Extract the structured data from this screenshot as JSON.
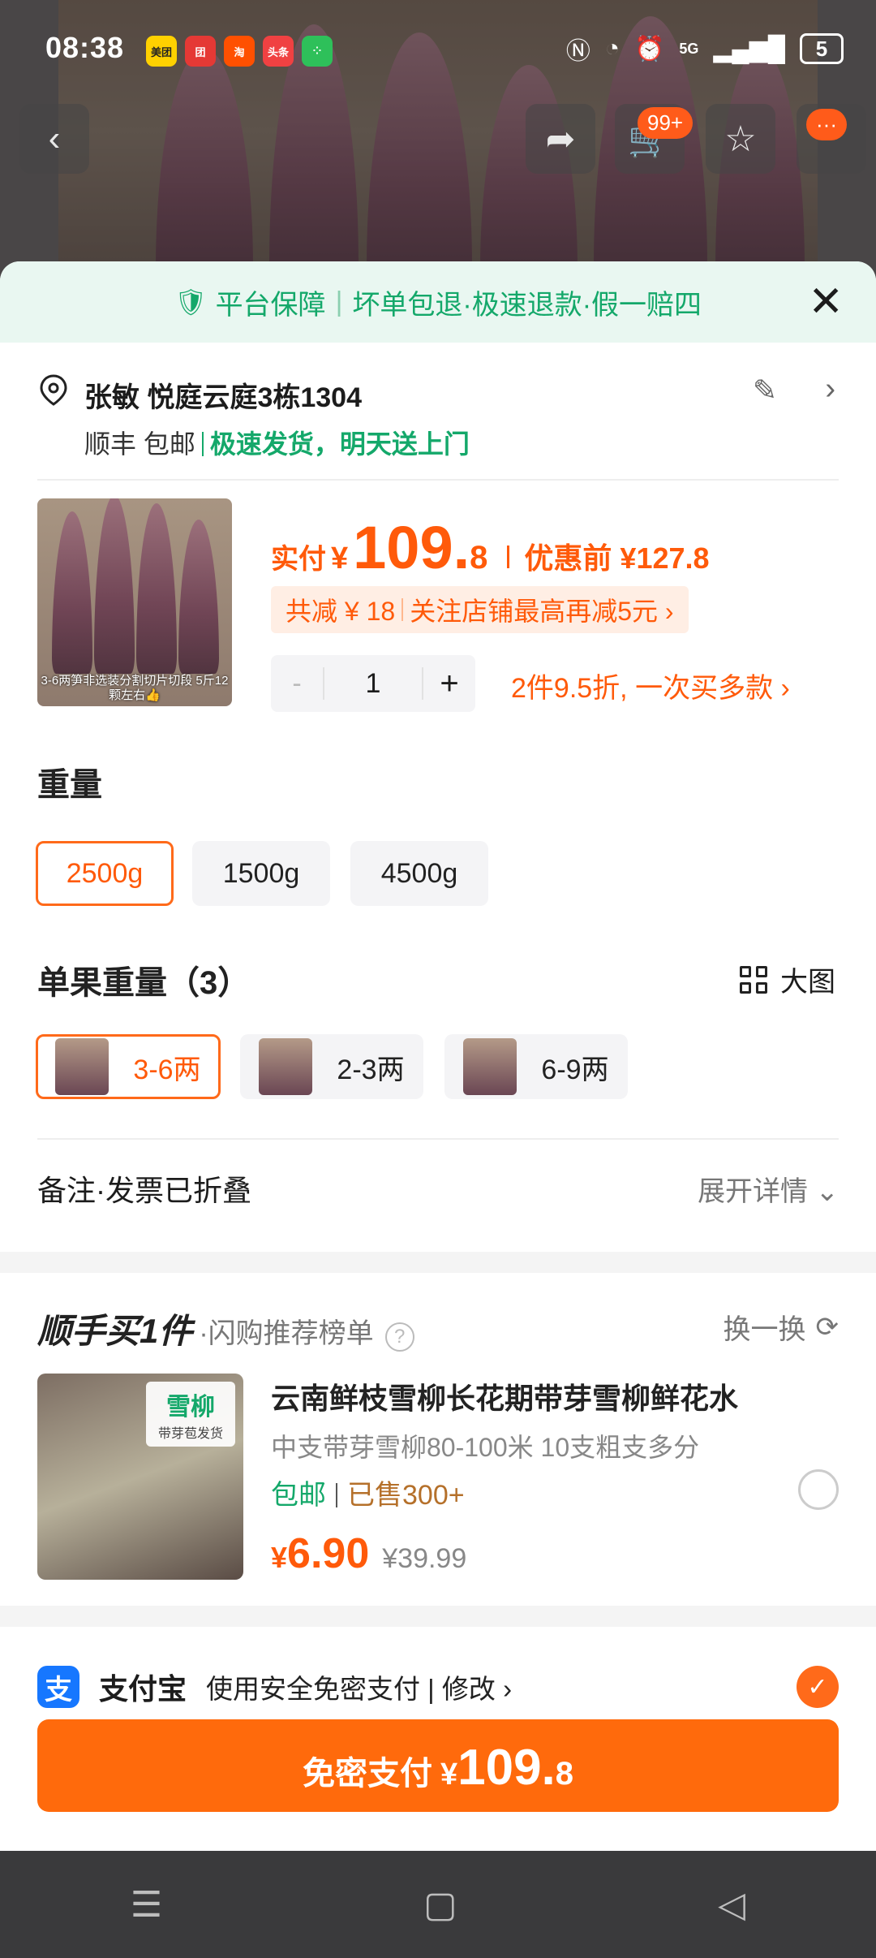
{
  "status": {
    "time": "08:38",
    "apps": [
      {
        "label": "美团",
        "bg": "#ffd100",
        "fg": "#222"
      },
      {
        "label": "团",
        "bg": "#e53935",
        "fg": "#fff"
      },
      {
        "label": "淘",
        "bg": "#ff5000",
        "fg": "#fff"
      },
      {
        "label": "头条",
        "bg": "#f04142",
        "fg": "#fff"
      },
      {
        "label": "⁘",
        "bg": "#2ec05a",
        "fg": "#fff"
      }
    ],
    "icons": [
      "nfc-icon",
      "data-saver-icon",
      "alarm-icon",
      "5g-icon",
      "signal-icon"
    ],
    "network": "5G",
    "battery": "5"
  },
  "header": {
    "cart_badge": "99+",
    "more_badge": "···"
  },
  "guarantee": {
    "title": "平台保障",
    "detail": "坏单包退·极速退款·假一赔四"
  },
  "address": {
    "name_line": "张敏 悦庭云庭3栋1304",
    "shipping": "顺丰 包邮",
    "delivery": "极速发货，明天送上门"
  },
  "product": {
    "thumb_caption": "3-6两笋非选装分割切片切段 5斤12颗左右👍",
    "paid_label": "实付",
    "currency": "¥",
    "price_int": "109.",
    "price_dec": "8",
    "before_label": "优惠前 ¥127.8",
    "discount_total": "共减 ¥ 18",
    "discount_extra": "关注店铺最高再减5元 ›",
    "qty_minus": "-",
    "qty": "1",
    "qty_plus": "+",
    "multi_buy": "2件9.5折, 一次买多款 ›"
  },
  "weight": {
    "title": "重量",
    "options": [
      {
        "label": "2500g",
        "selected": true
      },
      {
        "label": "1500g",
        "selected": false
      },
      {
        "label": "4500g",
        "selected": false
      }
    ]
  },
  "unit_weight": {
    "title": "单果重量（3）",
    "big_view": "大图",
    "options": [
      {
        "label": "3-6两",
        "selected": true
      },
      {
        "label": "2-3两",
        "selected": false
      },
      {
        "label": "6-9两",
        "selected": false
      }
    ]
  },
  "notes": {
    "label": "备注·发票已折叠",
    "expand": "展开详情 ⌄"
  },
  "recommend": {
    "title": "顺手买1件",
    "subtitle": "·闪购推荐榜单",
    "swap": "换一换",
    "item": {
      "tag_title": "雪柳",
      "tag_sub": "带芽苞发货",
      "name": "云南鲜枝雪柳长花期带芽雪柳鲜花水",
      "spec": "中支带芽雪柳80-100米 10支粗支多分",
      "free_ship": "包邮",
      "sold": "已售300+",
      "currency": "¥",
      "price": "6.90",
      "orig_price": "¥39.99"
    }
  },
  "payment": {
    "icon": "支",
    "name": "支付宝",
    "desc": "使用安全免密支付 | 修改 ›",
    "button_label": "免密支付",
    "button_currency": "¥",
    "button_int": "109.",
    "button_dec": "8"
  },
  "nav": {
    "menu": "☰",
    "home": "▢",
    "back": "◁"
  }
}
